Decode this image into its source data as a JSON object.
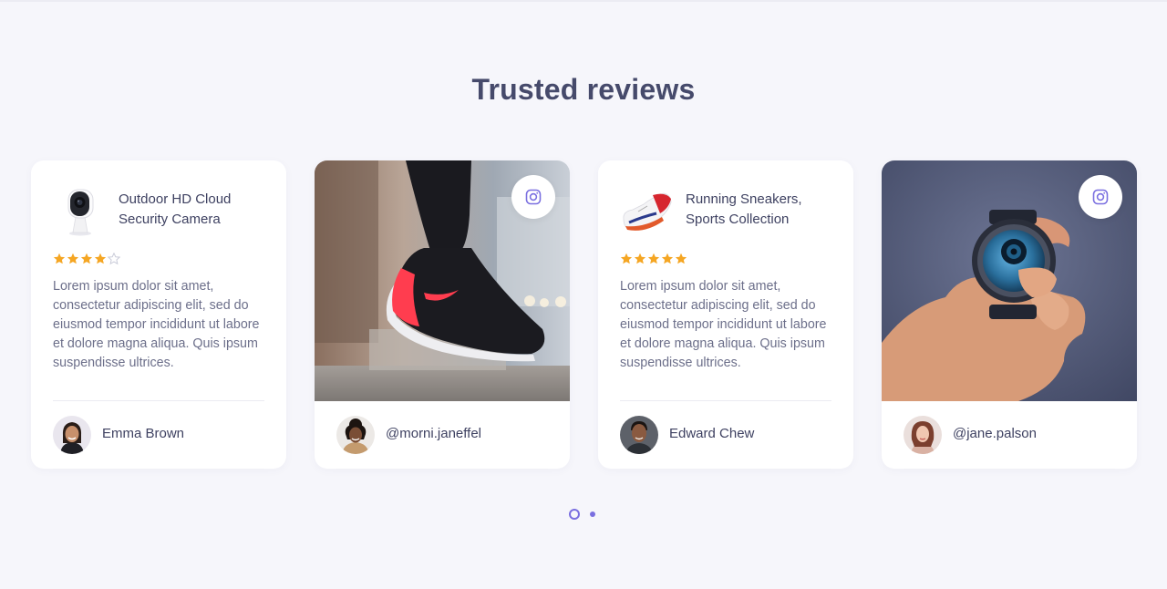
{
  "section": {
    "title": "Trusted reviews"
  },
  "colors": {
    "accent": "#7a6fe0",
    "star": "#f5a623",
    "star_empty": "#c9cbd8"
  },
  "cards": [
    {
      "type": "review",
      "product_name": "Outdoor HD Cloud Security Camera",
      "product_icon": "security-camera-icon",
      "rating": 4,
      "rating_max": 5,
      "text": "Lorem ipsum dolor sit amet, consectetur adipiscing elit, sed do eiusmod tempor incididunt ut labore et dolore magna aliqua. Quis ipsum suspendisse ultrices.",
      "author": "Emma Brown"
    },
    {
      "type": "instagram",
      "photo": "sneaker-jump-photo",
      "icon": "instagram-icon",
      "author": "@morni.janeffel"
    },
    {
      "type": "review",
      "product_name": "Running Sneakers, Sports Collection",
      "product_icon": "sneaker-icon",
      "rating": 5,
      "rating_max": 5,
      "text": "Lorem ipsum dolor sit amet, consectetur adipiscing elit, sed do eiusmod tempor incididunt ut labore et dolore magna aliqua. Quis ipsum suspendisse ultrices.",
      "author": "Edward Chew"
    },
    {
      "type": "instagram",
      "photo": "smartwatch-hand-photo",
      "icon": "instagram-icon",
      "author": "@jane.palson"
    }
  ],
  "pager": {
    "total": 2,
    "active": 1
  }
}
